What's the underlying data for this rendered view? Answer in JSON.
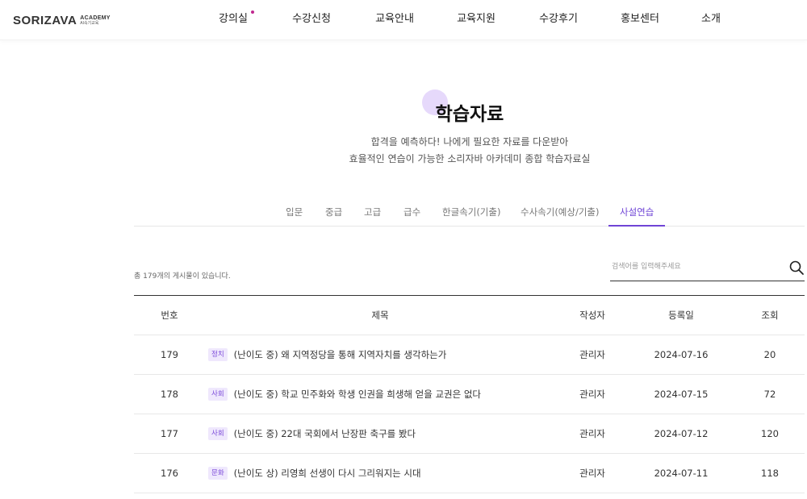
{
  "header": {
    "logo_text": "SORIZAVA",
    "logo_academy": "ACADEMY",
    "logo_tagline": "AI속기교육",
    "nav": [
      "강의실",
      "수강신청",
      "교육안내",
      "교육지원",
      "수강후기",
      "홍보센터",
      "소개"
    ],
    "accent_dot_color": "#c0288f"
  },
  "hero": {
    "title": "학습자료",
    "desc_line1": "합격을 예측하다! 나에게 필요한 자료를 다운받아",
    "desc_line2": "효율적인 연습이 가능한 소리자바 아카데미 종합 학습자료실"
  },
  "tabs": [
    "입문",
    "중급",
    "고급",
    "급수",
    "한글속기(기출)",
    "수사속기(예상/기출)",
    "사설연습"
  ],
  "active_tab": "사설연습",
  "accent_color": "#6f44d6",
  "board": {
    "count_text": "총 179개의 게시물이 있습니다.",
    "search_placeholder": "검색어를 입력해주세요",
    "search_icon": "search-icon",
    "columns": {
      "no": "번호",
      "title": "제목",
      "author": "작성자",
      "date": "등록일",
      "views": "조회"
    },
    "rows": [
      {
        "no": "179",
        "category": "정치",
        "title": "(난이도 중) 왜 지역정당을 통해 지역자치를 생각하는가",
        "author": "관리자",
        "date": "2024-07-16",
        "views": "20"
      },
      {
        "no": "178",
        "category": "사회",
        "title": "(난이도 중) 학교 민주화와 학생 인권을 희생해 얻을 교권은 없다",
        "author": "관리자",
        "date": "2024-07-15",
        "views": "72"
      },
      {
        "no": "177",
        "category": "사회",
        "title": "(난이도 중) 22대 국회에서 난장판 축구를 봤다",
        "author": "관리자",
        "date": "2024-07-12",
        "views": "120"
      },
      {
        "no": "176",
        "category": "문화",
        "title": "(난이도 상) 리영희 선생이 다시 그리워지는 시대",
        "author": "관리자",
        "date": "2024-07-11",
        "views": "118"
      }
    ]
  }
}
